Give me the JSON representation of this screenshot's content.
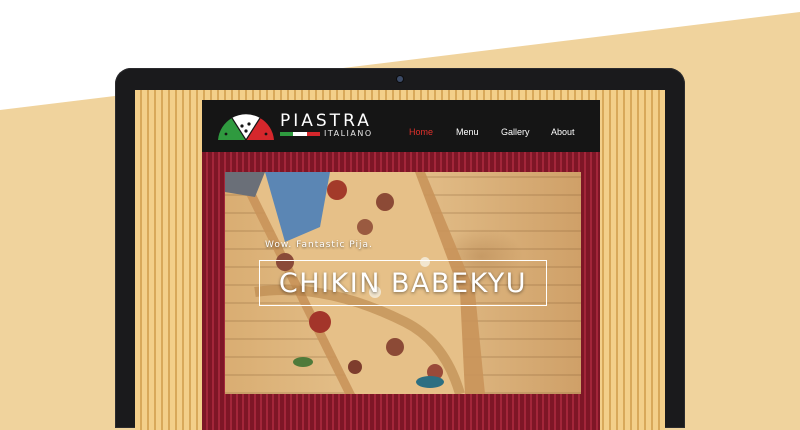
{
  "brand": {
    "name": "PIASTRA",
    "subtitle": "ITALIANO"
  },
  "nav": {
    "items": [
      {
        "label": "Home",
        "active": true
      },
      {
        "label": "Menu",
        "active": false
      },
      {
        "label": "Gallery",
        "active": false
      },
      {
        "label": "About",
        "active": false
      }
    ]
  },
  "hero": {
    "tagline": "Wow. Fantastic Pija.",
    "title": "CHIKIN BABEKYU"
  },
  "colors": {
    "background": "#f0d39d",
    "nav_background": "#151515",
    "active_nav": "#e0312c",
    "site_stripe": "#a3263a",
    "flag_green": "#2f9a3f",
    "flag_white": "#ffffff",
    "flag_red": "#d5272c"
  }
}
